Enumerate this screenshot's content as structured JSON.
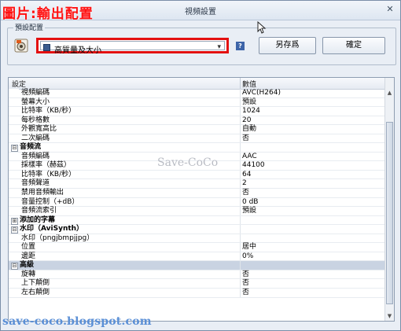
{
  "overlay_title": "圖片:輸出配置",
  "window": {
    "title": "視頻設置",
    "close_glyph": "✕"
  },
  "preset": {
    "group_label": "預設配置",
    "selected": "高質量及大小",
    "help_glyph": "?",
    "save_as_label": "另存爲",
    "ok_label": "確定"
  },
  "grid": {
    "headers": {
      "setting": "設定",
      "value": "數值"
    },
    "rows": [
      {
        "kind": "item",
        "name": "視頻編碼",
        "value": "AVC(H264)"
      },
      {
        "kind": "item",
        "name": "螢幕大小",
        "value": "預設"
      },
      {
        "kind": "item",
        "name": "比特率（KB/秒）",
        "value": "1024"
      },
      {
        "kind": "item",
        "name": "每秒格數",
        "value": "20"
      },
      {
        "kind": "item",
        "name": "外觀寬高比",
        "value": "自動"
      },
      {
        "kind": "item",
        "name": "二次編碼",
        "value": "否"
      },
      {
        "kind": "cat",
        "name": "音頻流",
        "expander": "⊟",
        "selected": false
      },
      {
        "kind": "item",
        "name": "音頻編碼",
        "value": "AAC"
      },
      {
        "kind": "item",
        "name": "採樣率（赫茲）",
        "value": "44100"
      },
      {
        "kind": "item",
        "name": "比特率（KB/秒）",
        "value": "64"
      },
      {
        "kind": "item",
        "name": "音頻聲道",
        "value": "2"
      },
      {
        "kind": "item",
        "name": "禁用音頻輸出",
        "value": "否"
      },
      {
        "kind": "item",
        "name": "音量控制（+dB）",
        "value": "0 dB"
      },
      {
        "kind": "item",
        "name": "音頻流索引",
        "value": "預設"
      },
      {
        "kind": "cat",
        "name": "添加的字幕",
        "expander": "⊞",
        "selected": false
      },
      {
        "kind": "cat",
        "name": "水印（AviSynth）",
        "expander": "⊟",
        "selected": false
      },
      {
        "kind": "item",
        "name": "水印（pngjbmpjjpg）",
        "value": ""
      },
      {
        "kind": "item",
        "name": "位置",
        "value": "居中"
      },
      {
        "kind": "item",
        "name": "邊距",
        "value": "0%"
      },
      {
        "kind": "cat",
        "name": "高級",
        "expander": "⊟",
        "selected": true
      },
      {
        "kind": "item",
        "name": "旋轉",
        "value": "否"
      },
      {
        "kind": "item",
        "name": "上下顛倒",
        "value": "否"
      },
      {
        "kind": "item",
        "name": "左右顛倒",
        "value": "否"
      }
    ]
  },
  "watermarks": {
    "middle": "Save-CoCo",
    "bottom": "save-coco.blogspot.com"
  },
  "colors": {
    "highlight": "#e31010",
    "selected_row": "#c9d3e2",
    "blog_text": "#5a8fd6"
  }
}
